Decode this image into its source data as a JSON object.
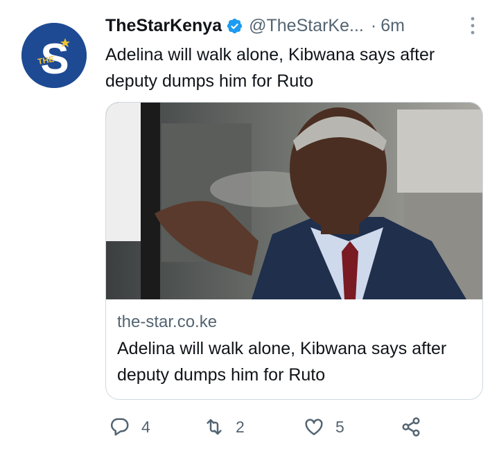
{
  "account": {
    "name": "TheStarKenya",
    "handle": "@TheStarKe...",
    "separator": "·",
    "time": "6m",
    "avatar_letter": "S",
    "avatar_small_text": "THE",
    "verified_icon": "verified-badge-icon"
  },
  "tweet": {
    "text": "Adelina will walk alone, Kibwana says after deputy dumps him for Ruto"
  },
  "card": {
    "domain": "the-star.co.ke",
    "title": "Adelina will walk alone, Kibwana says after deputy dumps him for Ruto"
  },
  "actions": {
    "replies": "4",
    "retweets": "2",
    "likes": "5"
  },
  "colors": {
    "text": "#0f1419",
    "secondary": "#536471",
    "verified": "#1d9bf0",
    "avatar_bg": "#1e4a93",
    "border": "#cfd9de"
  }
}
